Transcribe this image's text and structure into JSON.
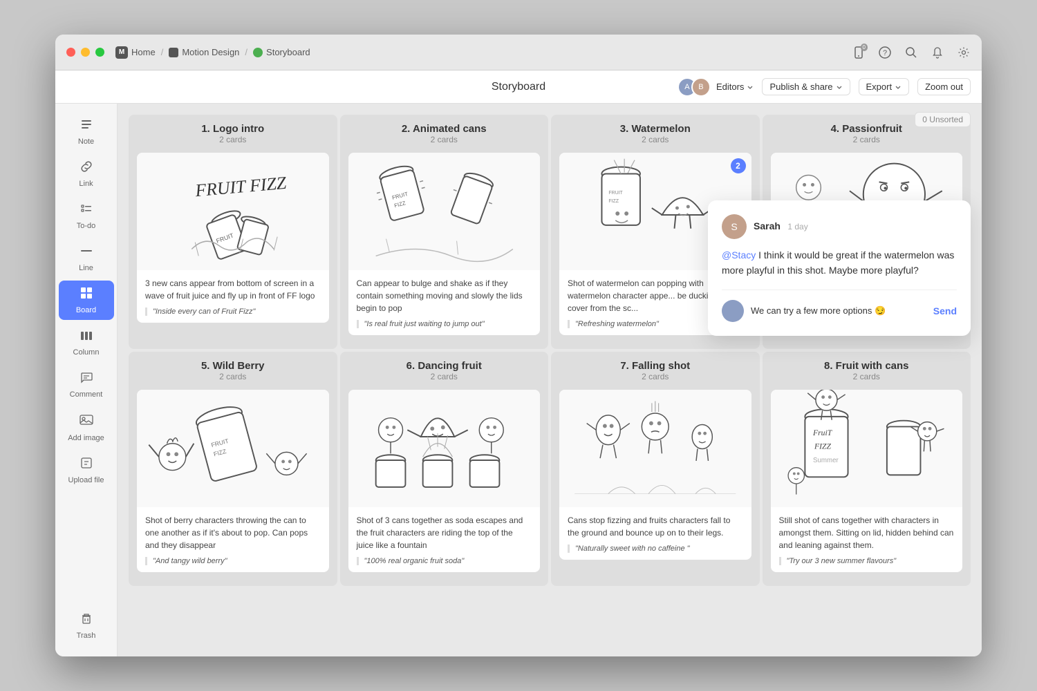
{
  "window": {
    "title": "Storyboard",
    "breadcrumb": {
      "home": "Home",
      "project": "Motion Design",
      "board": "Storyboard"
    }
  },
  "titlebar": {
    "icon_count": "0",
    "home_label": "Home",
    "motion_label": "Motion Design",
    "storyboard_label": "Storyboard"
  },
  "topbar": {
    "title": "Storyboard",
    "editors_label": "Editors",
    "publish_label": "Publish & share",
    "export_label": "Export",
    "zoom_label": "Zoom out",
    "unsorted_label": "0 Unsorted"
  },
  "sidebar": {
    "items": [
      {
        "label": "Note",
        "icon": "≡"
      },
      {
        "label": "Link",
        "icon": "🔗"
      },
      {
        "label": "To-do",
        "icon": "☰"
      },
      {
        "label": "Line",
        "icon": "—"
      },
      {
        "label": "Board",
        "icon": "⊞",
        "active": true
      },
      {
        "label": "Column",
        "icon": "▬"
      },
      {
        "label": "Comment",
        "icon": "≡"
      },
      {
        "label": "Add image",
        "icon": "🖼"
      },
      {
        "label": "Upload file",
        "icon": "📄"
      }
    ],
    "trash_label": "Trash"
  },
  "columns": [
    {
      "title": "1. Logo intro",
      "subtitle": "2 cards",
      "cards": [
        {
          "desc": "3 new cans appear from bottom of screen  in a wave of fruit juice and fly up in front of FF logo",
          "quote": "\"Inside every can of Fruit Fizz\""
        }
      ]
    },
    {
      "title": "2. Animated cans",
      "subtitle": "2 cards",
      "cards": [
        {
          "desc": "Can appear to bulge and shake as if they contain something moving and slowly the lids begin to pop",
          "quote": "\"Is real fruit just waiting to jump out\""
        }
      ]
    },
    {
      "title": "3. Watermelon",
      "subtitle": "2 cards",
      "cards": [
        {
          "desc": "Shot of watermelon can popping with watermelon character appe... be ducking for cover from the sc...",
          "quote": "\"Refreshing watermelon\""
        }
      ]
    },
    {
      "title": "4. Passionfruit",
      "subtitle": "2 cards",
      "cards": [
        {
          "desc": "",
          "quote": ""
        }
      ]
    },
    {
      "title": "5. Wild Berry",
      "subtitle": "2 cards",
      "cards": [
        {
          "desc": "Shot of berry characters throwing the can to one another as if it's about to pop. Can pops and they disappear",
          "quote": "\"And tangy wild berry\""
        }
      ]
    },
    {
      "title": "6. Dancing fruit",
      "subtitle": "2 cards",
      "cards": [
        {
          "desc": "Shot of 3 cans together as soda escapes and the fruit characters are riding the top of the juice like a fountain",
          "quote": "\"100% real organic fruit soda\""
        }
      ]
    },
    {
      "title": "7. Falling shot",
      "subtitle": "2 cards",
      "cards": [
        {
          "desc": "Cans stop fizzing and fruits characters fall to the ground and bounce up on to their legs.",
          "quote": "\"Naturally sweet with no caffeine \""
        }
      ]
    },
    {
      "title": "8. Fruit with cans",
      "subtitle": "2 cards",
      "cards": [
        {
          "desc": "Still shot of cans together with characters in amongst them. Sitting on lid, hidden behind can and leaning against them.",
          "quote": "\"Try our 3 new summer flavours\""
        }
      ]
    }
  ],
  "comment": {
    "author": "Sarah",
    "time": "1 day",
    "mention": "@Stacy",
    "text": " I think it would be great if the watermelon was more playful in this shot. Maybe more playful?",
    "reply_text": "We can try a few more options 😏",
    "send_label": "Send",
    "badge": "2"
  }
}
